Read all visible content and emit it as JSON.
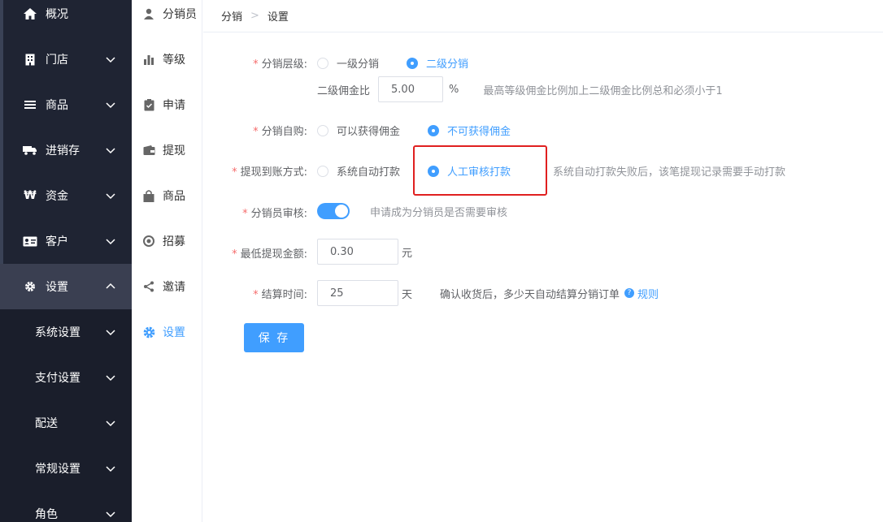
{
  "sidebar": {
    "items": [
      {
        "label": "概况",
        "icon": "home-icon"
      },
      {
        "label": "门店",
        "icon": "building-icon"
      },
      {
        "label": "商品",
        "icon": "list-icon"
      },
      {
        "label": "进销存",
        "icon": "truck-icon"
      },
      {
        "label": "资金",
        "icon": "won-icon"
      },
      {
        "label": "客户",
        "icon": "id-card-icon"
      },
      {
        "label": "设置",
        "icon": "gear-icon"
      }
    ],
    "sub_items": [
      {
        "label": "系统设置"
      },
      {
        "label": "支付设置"
      },
      {
        "label": "配送"
      },
      {
        "label": "常规设置"
      },
      {
        "label": "角色"
      }
    ]
  },
  "subnav": {
    "items": [
      {
        "label": "分销员",
        "icon": "user-icon"
      },
      {
        "label": "等级",
        "icon": "bar-chart-icon"
      },
      {
        "label": "申请",
        "icon": "clipboard-icon"
      },
      {
        "label": "提现",
        "icon": "wallet-icon"
      },
      {
        "label": "商品",
        "icon": "bag-icon"
      },
      {
        "label": "招募",
        "icon": "target-icon"
      },
      {
        "label": "邀请",
        "icon": "share-icon"
      },
      {
        "label": "设置",
        "icon": "gear-icon"
      }
    ]
  },
  "breadcrumb": {
    "first": "分销",
    "separator": ">",
    "second": "设置"
  },
  "form": {
    "level": {
      "label": "分销层级:",
      "option1": "一级分销",
      "option2": "二级分销"
    },
    "commission": {
      "label": "二级佣金比",
      "value": "5.00",
      "unit": "%",
      "hint": "最高等级佣金比例加上二级佣金比例总和必须小于1"
    },
    "self_buy": {
      "label": "分销自购:",
      "option1": "可以获得佣金",
      "option2": "不可获得佣金"
    },
    "withdraw": {
      "label": "提现到账方式:",
      "option1": "系统自动打款",
      "option2": "人工审核打款",
      "hint": "系统自动打款失败后，该笔提现记录需要手动打款"
    },
    "review": {
      "label": "分销员审核:",
      "hint": "申请成为分销员是否需要审核"
    },
    "min_withdraw": {
      "label": "最低提现金额:",
      "value": "0.30",
      "unit": "元"
    },
    "settle": {
      "label": "结算时间:",
      "value": "25",
      "unit": "天",
      "hint": "确认收货后，多少天自动结算分销订单",
      "link": "规则"
    },
    "required_mark": "*",
    "save_label": "保 存"
  },
  "colors": {
    "primary": "#409eff",
    "sidebar_bg": "#1f2433",
    "required": "#f56c6c",
    "highlight": "#e02020"
  }
}
